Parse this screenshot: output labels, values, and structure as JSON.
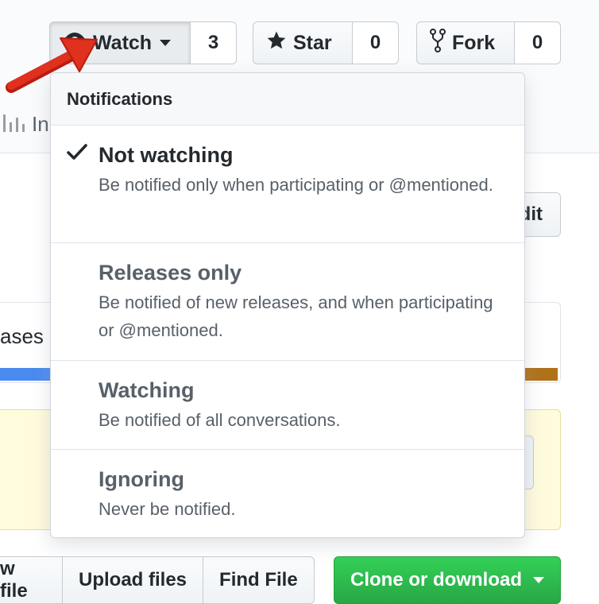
{
  "watch": {
    "label": "Watch",
    "count": "3"
  },
  "star": {
    "label": "Star",
    "count": "0"
  },
  "fork": {
    "label": "Fork",
    "count": "0"
  },
  "tabs": {
    "insights_partial": "In"
  },
  "side": {
    "edit_partial": "dit",
    "languages_partial": "ases"
  },
  "file_actions": {
    "new_file_partial": "w file",
    "upload": "Upload files",
    "find": "Find File",
    "clone": "Clone or download"
  },
  "notifications": {
    "title": "Notifications",
    "options": [
      {
        "title": "Not watching",
        "desc": "Be notified only when participating or @mentioned.",
        "selected": true
      },
      {
        "title": "Releases only",
        "desc": "Be notified of new releases, and when participating or @mentioned.",
        "selected": false
      },
      {
        "title": "Watching",
        "desc": "Be notified of all conversations.",
        "selected": false
      },
      {
        "title": "Ignoring",
        "desc": "Never be notified.",
        "selected": false
      }
    ]
  },
  "colors": {
    "accent_arrow": "#e0301e",
    "clone_green": "#28a745",
    "lang_blue": "#4a8bf0",
    "lang_brown": "#b07219"
  }
}
